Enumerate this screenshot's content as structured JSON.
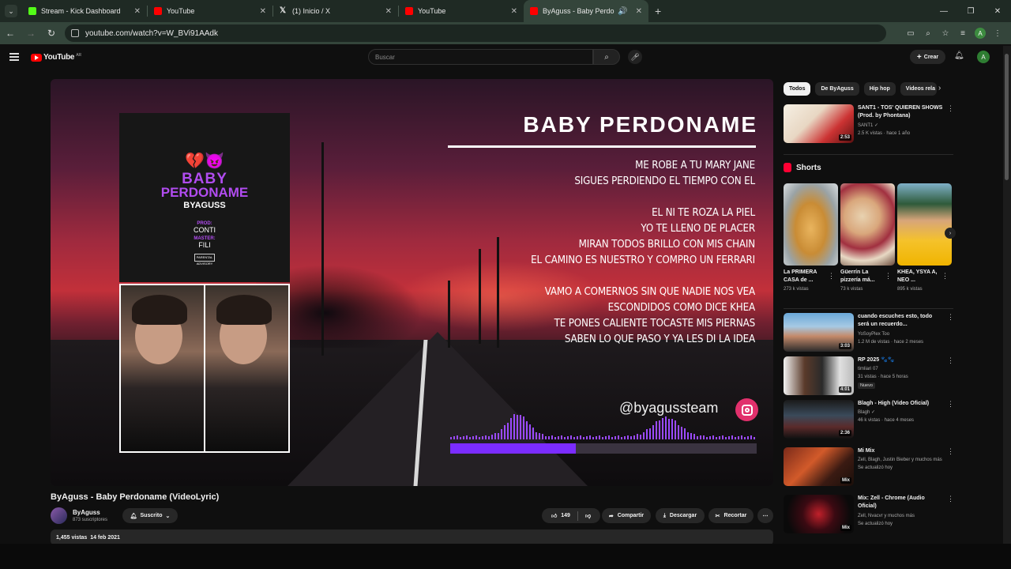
{
  "browser": {
    "tabs": [
      {
        "label": "Stream - Kick Dashboard",
        "color": "#53fc18"
      },
      {
        "label": "YouTube",
        "color": "#ff0000"
      },
      {
        "label": "(1) Inicio / X",
        "color": "#e7e7e7"
      },
      {
        "label": "YouTube",
        "color": "#ff0000"
      },
      {
        "label": "ByAguss - Baby Perdoname",
        "color": "#ff0000"
      }
    ],
    "url": "youtube.com/watch?v=W_BVi91AAdk",
    "account_initial": "A"
  },
  "youtube": {
    "logo": "YouTube",
    "region": "AR",
    "search_placeholder": "Buscar",
    "create_label": "Crear",
    "avatar_initial": "A"
  },
  "video": {
    "title": "ByAguss - Baby Perdoname (VideoLyric)",
    "lyric_title": "BABY PERDONAME",
    "lyrics": [
      "ME ROBE A TU MARY JANE",
      "SIGUES PERDIENDO EL TIEMPO CON EL",
      "",
      "EL NI TE ROZA LA PIEL",
      "YO TE LLENO DE PLACER",
      "MIRAN TODOS BRILLO CON MIS CHAIN",
      "EL CAMINO ES NUESTRO Y COMPRO UN FERRARI",
      "",
      "VAMO A COMERNOS SIN QUE NADIE NOS VEA",
      "ESCONDIDOS COMO DICE KHEA",
      "TE PONES CALIENTE TOCASTE MIS PIERNAS",
      "SABEN LO QUE PASO Y YA LES DI LA IDEA"
    ],
    "handle": "@byagussteam",
    "cover": {
      "emoji": "💔😈",
      "line1": "BABY",
      "line2": "PERDONAME",
      "artist": "BYAGUSS",
      "prod_label": "PROD:",
      "prod": "CONTI",
      "master_label": "MASTER:",
      "master": "FILI",
      "advisory": "PARENTAL ADVISORY"
    },
    "progress": 0.41,
    "channel": {
      "name": "ByAguss",
      "subscribers": "873 suscriptores",
      "subscribed_label": "Suscrito"
    },
    "likes": "149",
    "share_label": "Compartir",
    "download_label": "Descargar",
    "clip_label": "Recortar",
    "views": "1,455 vistas",
    "date": "14 feb 2021"
  },
  "sidebar": {
    "chips": [
      "Todos",
      "De ByAguss",
      "Hip hop",
      "Videos rela"
    ],
    "shorts_title": "Shorts",
    "shorts": [
      {
        "title": "La PRIMERA CASA de ...",
        "views": "273 k vistas"
      },
      {
        "title": "Güerrín La pizzería má...",
        "views": "73 k vistas"
      },
      {
        "title": "KHEA, YSYA A, NEO ...",
        "views": "895 k vistas"
      }
    ],
    "recs_top": [
      {
        "title": "SANT1 - TOS' QUIEREN SHOWS (Prod. by Phontana)",
        "channel": "SANT1 ✓",
        "meta": "2.5 K vistas · hace 1 año",
        "duration": "2:53"
      }
    ],
    "recs": [
      {
        "title": "cuando escuches esto, todo será un recuerdo...",
        "channel": "YoSoyPlex Too",
        "meta": "1.2 M de vistas · hace 2 meses",
        "duration": "3:03"
      },
      {
        "title": "RP 2025 🐾🐾",
        "channel": "timliari 07",
        "meta": "31 vistas · hace 5 horas",
        "duration": "4:01",
        "badge": "Nuevo"
      },
      {
        "title": "Blagh - High (Video Oficial)",
        "channel": "Blagh ✓",
        "meta": "46 k vistas · hace 4 meses",
        "duration": "2:36"
      },
      {
        "title": "Mi Mix",
        "channel": "Zell, Blagh, Justin Bieber y muchos más",
        "meta": "Se actualizó hoy",
        "duration": "Mix"
      },
      {
        "title": "Mix: Zell - Chrome (Audio Oficial)",
        "channel": "Zell, Nvacvr y muchos más",
        "meta": "Se actualizó hoy",
        "duration": "Mix"
      }
    ]
  }
}
